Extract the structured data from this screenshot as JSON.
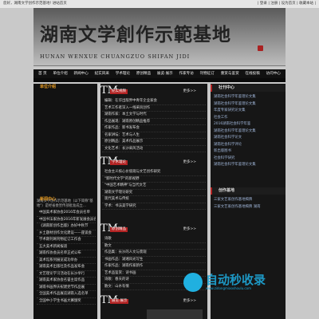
{
  "topbar": {
    "left": "您好，湖南文学创作示范基地! 进站首页",
    "right": "| 登录 | 注册 | 设为首页 | 收藏本站 |"
  },
  "banner": {
    "title": "湖南文学創作示範基地",
    "subtitle": "HUNAN WENXUE CHUANGZUO SHIFAN JIDI"
  },
  "nav": [
    "首 页",
    "单位介绍",
    "新闻中心",
    "纪实风采",
    "学术理论",
    "原创精品",
    "展览·展示",
    "作家专访",
    "刊物征订",
    "重赏与鉴赏",
    "在线投稿",
    "访问中心"
  ],
  "left": {
    "title": "单位介绍",
    "intro": "湖南文学创作示范基地（以下简称\"基地\"）是经省委宣传部批准成立...",
    "news_title": "新闻中心",
    "news": [
      "中国美术家协会2016年会员名单",
      "中国书法家协会2016年新发展会员名单",
      "《湖南新创作出版》办好中秋节",
      "乡土题材创作文化建设——座谈会",
      "学术期刊网刊物征订工作会",
      "五大美术新闻报道",
      "湖南作协会员名单正式公布",
      "美术馆系列展览成功举办",
      "湖南美术出版社及作品发布会",
      "文艺理论学习活动在长沙举行",
      "湖南美术家协会名誉主席作品",
      "湖南书画界庆祝建党节作品展",
      "全国美术作品展览湖南入选名单",
      "全国中小学生书画大赛颁奖"
    ]
  },
  "mid": {
    "s1": {
      "title": "纪实视频",
      "more": "更多>>",
      "items": [
        "编辑：在华出版界中青年企业家会",
        "艺术工作者深入一线采风创作",
        "湖南作家：本土文学与时代",
        "作品展现：湖南原创精品推荐",
        "作家作品：新书发布会",
        "名家讲坛：艺术与人生",
        "原创精品：美术作品展示",
        "文化艺术：长沙采风活动"
      ]
    },
    "s2": {
      "title": "学术理论",
      "more": "更多>>",
      "items": [
        "社会主义核心价值观与文艺创作研究",
        "\"新时代文学\"的新视野",
        "\"中国艺术精神\"与当代文艺",
        "湖南文学理论研究",
        "现代美术与传统",
        "学术：书法美学研究"
      ]
    },
    "s3": {
      "title": "原创精品",
      "more": "更多>>",
      "items": [
        "诗歌",
        "散文",
        "作品集：长沙的人文与景观",
        "书画作品：湖湘风光写生",
        "作家作品：湖南作家新作",
        "艺术品鉴赏：诗书画",
        "诗歌：春天的诗",
        "散文：山水有情"
      ]
    },
    "s4": {
      "title": "展览·展示",
      "more": "更多>>"
    }
  },
  "right": {
    "t1": "社刊中心",
    "t1items": [
      "湖南社会科学年鉴理论文集",
      "湖南社会科学年鉴理论文集",
      "年度专家研究论文集",
      "社会工作",
      "2016湖南社会科学年鉴",
      "湖南社会科学年鉴理论文集",
      "湖南社会科学论文",
      "湖南社会科学评论",
      "新出版图书",
      "社会科学研究",
      "湖南社会科学年鉴理论文集"
    ],
    "t2": "创作基地",
    "t2items": [
      "三家文艺家创作基地揭牌",
      "三家文艺家创作基地揭牌 湖南"
    ]
  },
  "watermark": {
    "brand": "自动秒收录",
    "url": "www.zidongmiaoshoulu.com"
  }
}
